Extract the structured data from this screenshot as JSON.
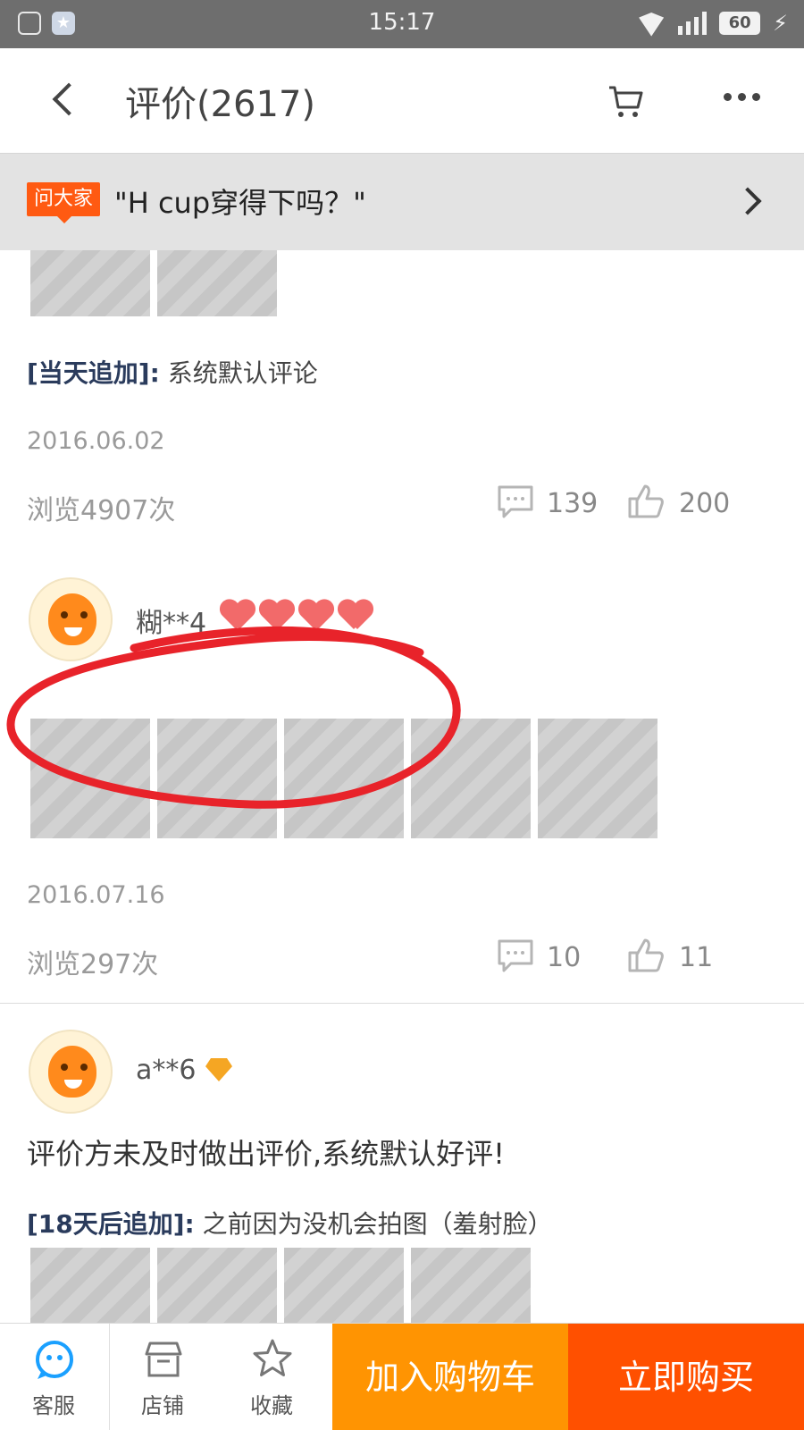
{
  "status_bar": {
    "time": "15:17",
    "battery": "60"
  },
  "nav": {
    "title": "评价(2617)"
  },
  "ask": {
    "tag": "问大家",
    "question": "\"H cup穿得下吗？\""
  },
  "review_prev": {
    "append_label": "[当天追加]:",
    "append_text": "系统默认评论",
    "date": "2016.06.02",
    "views": "浏览4907次",
    "comments": "139",
    "likes": "200"
  },
  "review_1": {
    "username": "糊**4",
    "text": "",
    "date": "2016.07.16",
    "views": "浏览297次",
    "comments": "10",
    "likes": "11"
  },
  "review_2": {
    "username": "a**6",
    "text": "评价方未及时做出评价,系统默认好评!",
    "append_label": "[18天后追加]:",
    "append_text": "之前因为没机会拍图（羞射脸）"
  },
  "bottom_bar": {
    "service": "客服",
    "store": "店铺",
    "favorite": "收藏",
    "add_to_cart": "加入购物车",
    "buy_now": "立即购买"
  },
  "colors": {
    "accent_orange": "#ff9402",
    "accent_red": "#ff5000",
    "tag": "#ff5a12",
    "annotation": "#e8232a"
  }
}
